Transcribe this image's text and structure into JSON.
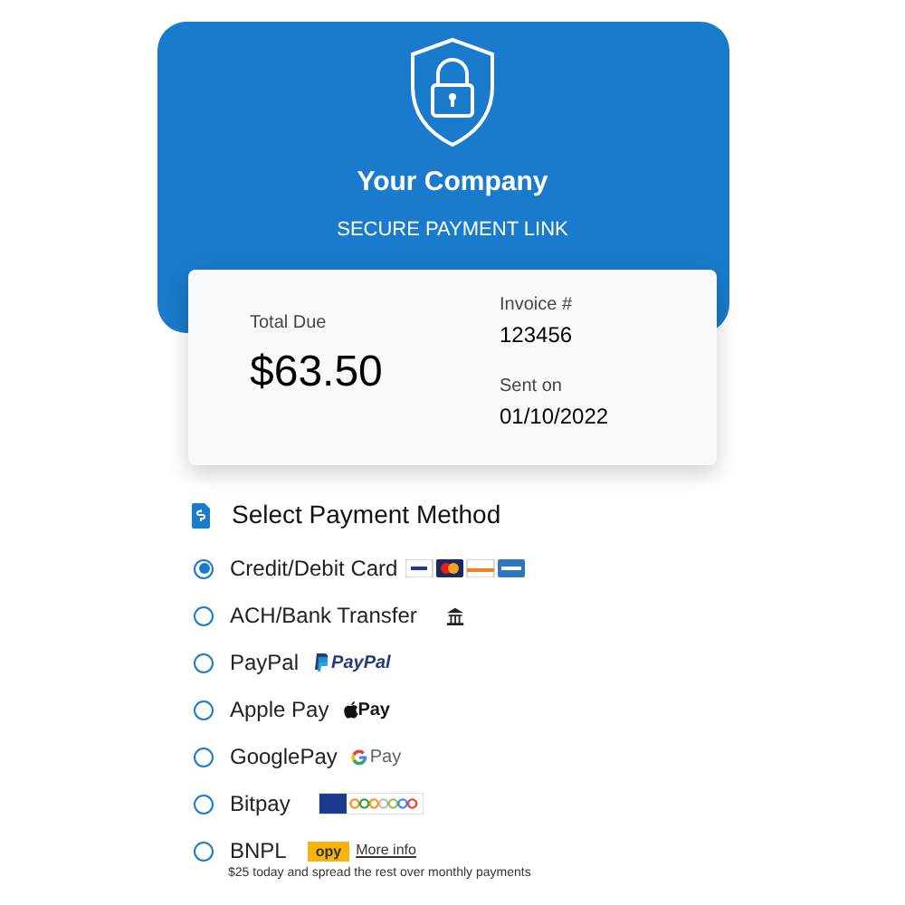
{
  "header": {
    "company": "Your Company",
    "subtitle": "SECURE PAYMENT LINK"
  },
  "summary": {
    "total_label": "Total Due",
    "total": "$63.50",
    "invoice_label": "Invoice #",
    "invoice": "123456",
    "sent_label": "Sent on",
    "sent": "01/10/2022"
  },
  "payment": {
    "title": "Select Payment Method",
    "methods": [
      {
        "label": "Credit/Debit Card",
        "kind": "cards",
        "selected": true
      },
      {
        "label": "ACH/Bank Transfer",
        "kind": "bank",
        "selected": false
      },
      {
        "label": "PayPal",
        "kind": "paypal",
        "logo_text": "PayPal",
        "selected": false
      },
      {
        "label": "Apple Pay",
        "kind": "applepay",
        "logo_text": "Pay",
        "selected": false
      },
      {
        "label": "GooglePay",
        "kind": "googlepay",
        "logo_text": "Pay",
        "selected": false
      },
      {
        "label": "Bitpay",
        "kind": "bitpay",
        "selected": false
      },
      {
        "label": "BNPL",
        "kind": "bnpl",
        "logo_text": "opy",
        "link": "More info",
        "note": "$25 today and spread the rest over monthly payments",
        "selected": false
      }
    ]
  }
}
